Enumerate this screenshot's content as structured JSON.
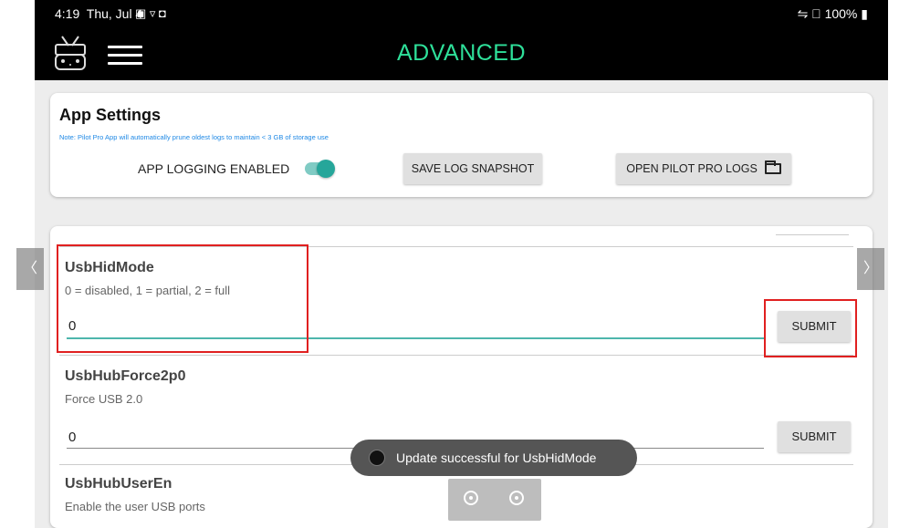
{
  "status_bar": {
    "time": "4:19",
    "date": "Thu, Jul 4",
    "battery": "100%",
    "notification_icons": "▣ ▿ ◘",
    "right_icons": "⇋ ⃠"
  },
  "app_bar": {
    "title": "ADVANCED",
    "accent_color": "#2ee09a"
  },
  "app_settings": {
    "heading": "App Settings",
    "note": "Note: Pilot Pro App will automatically prune oldest logs to maintain  <  3 GB of storage use",
    "logging_label": "APP LOGGING ENABLED",
    "logging_enabled": true,
    "save_button": "SAVE LOG SNAPSHOT",
    "open_button": "OPEN PILOT PRO LOGS"
  },
  "params": [
    {
      "name": "UsbHidMode",
      "description": "0 = disabled, 1 = partial, 2 = full",
      "value": "0",
      "button": "SUBMIT"
    },
    {
      "name": "UsbHubForce2p0",
      "description": "Force USB 2.0",
      "value": "0",
      "button": "SUBMIT"
    },
    {
      "name": "UsbHubUserEn",
      "description": "Enable the user USB ports"
    }
  ],
  "toast": {
    "text": "Update successful for UsbHidMode"
  },
  "nav": {
    "prev_arrow": "〈",
    "next_arrow": "〉"
  },
  "highlight_color": "#e02020"
}
